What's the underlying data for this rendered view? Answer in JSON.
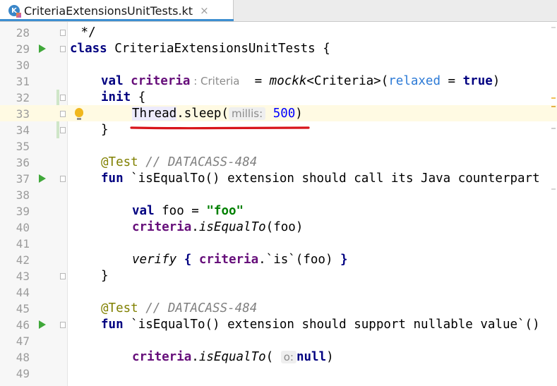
{
  "tab": {
    "filename": "CriteriaExtensionsUnitTests.kt",
    "close_glyph": "×",
    "icon": "kotlin-file-icon"
  },
  "lines": [
    {
      "n": "28",
      "code": " */"
    },
    {
      "n": "29",
      "p1": "class",
      "p2": " CriteriaExtensionsUnitTests {"
    },
    {
      "n": "30"
    },
    {
      "n": "31",
      "kw": "val",
      "prop": "criteria",
      "hint": ": Criteria",
      "p3": "  = ",
      "fn": "mockk",
      "p4": "<Criteria>(",
      "named": "relaxed",
      "p5": " = ",
      "kw2": "true",
      "p6": ")"
    },
    {
      "n": "32",
      "kw": "init",
      "p2": " {"
    },
    {
      "n": "33",
      "cls": "Thread",
      "p2": ".sleep(",
      "hint": "millis:",
      "num": "500",
      "p3": ")"
    },
    {
      "n": "34",
      "code": "}"
    },
    {
      "n": "35"
    },
    {
      "n": "36",
      "ann": "@Test",
      "cmt": " // DATACASS-484"
    },
    {
      "n": "37",
      "kw": "fun",
      "p2": " `isEqualTo() extension should call its Java counterpart"
    },
    {
      "n": "38"
    },
    {
      "n": "39",
      "kw": "val",
      "p2": " foo = ",
      "str": "\"foo\""
    },
    {
      "n": "40",
      "prop": "criteria",
      "p2": ".",
      "fn": "isEqualTo",
      "p3": "(foo)"
    },
    {
      "n": "41"
    },
    {
      "n": "42",
      "fn": "verify",
      "b1": " { ",
      "prop": "criteria",
      "p2": ".`is`(foo) ",
      "b2": "}"
    },
    {
      "n": "43",
      "code": "}"
    },
    {
      "n": "44"
    },
    {
      "n": "45",
      "ann": "@Test",
      "cmt": " // DATACASS-484"
    },
    {
      "n": "46",
      "kw": "fun",
      "p2": " `isEqualTo() extension should support nullable value`()"
    },
    {
      "n": "47"
    },
    {
      "n": "48",
      "prop": "criteria",
      "p2": ".",
      "fn": "isEqualTo",
      "p3": "( ",
      "hint": "o:",
      "kw2": "null",
      "p4": ")"
    },
    {
      "n": "49"
    }
  ],
  "icons": {
    "run": "run-gutter-icon",
    "fold": "fold-icon",
    "bulb": "intention-bulb-icon"
  },
  "colors": {
    "underline": "#d8141a",
    "keyword": "#000080",
    "property": "#660e7a",
    "string": "#008000",
    "number": "#0000ff",
    "annotation": "#808000"
  }
}
